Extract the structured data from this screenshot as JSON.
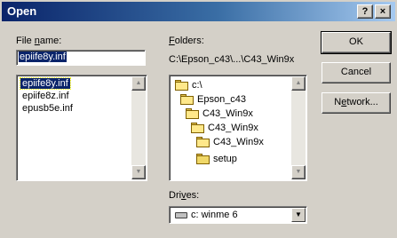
{
  "window": {
    "title": "Open",
    "help_label": "?",
    "close_label": "×"
  },
  "file_name": {
    "label_pre": "File ",
    "label_u": "n",
    "label_post": "ame:",
    "value": "epiife8y.inf",
    "files": [
      "epiife8y.inf",
      "epiife8z.inf",
      "epusb5e.inf"
    ],
    "selected_index": 0
  },
  "folders": {
    "label_u": "F",
    "label_post": "olders:",
    "current_path": "C:\\Epson_c43\\...\\C43_Win9x",
    "items": [
      "c:\\",
      "Epson_c43",
      "C43_Win9x",
      "C43_Win9x",
      "C43_Win9x",
      "setup"
    ]
  },
  "drives": {
    "label_pre": "Dri",
    "label_u": "v",
    "label_post": "es:",
    "value": "c: winme 6"
  },
  "buttons": {
    "ok": "OK",
    "cancel": "Cancel",
    "network_pre": "N",
    "network_u": "e",
    "network_post": "twork..."
  },
  "icons": {
    "folder": "folder-icon",
    "drive": "drive-icon"
  }
}
